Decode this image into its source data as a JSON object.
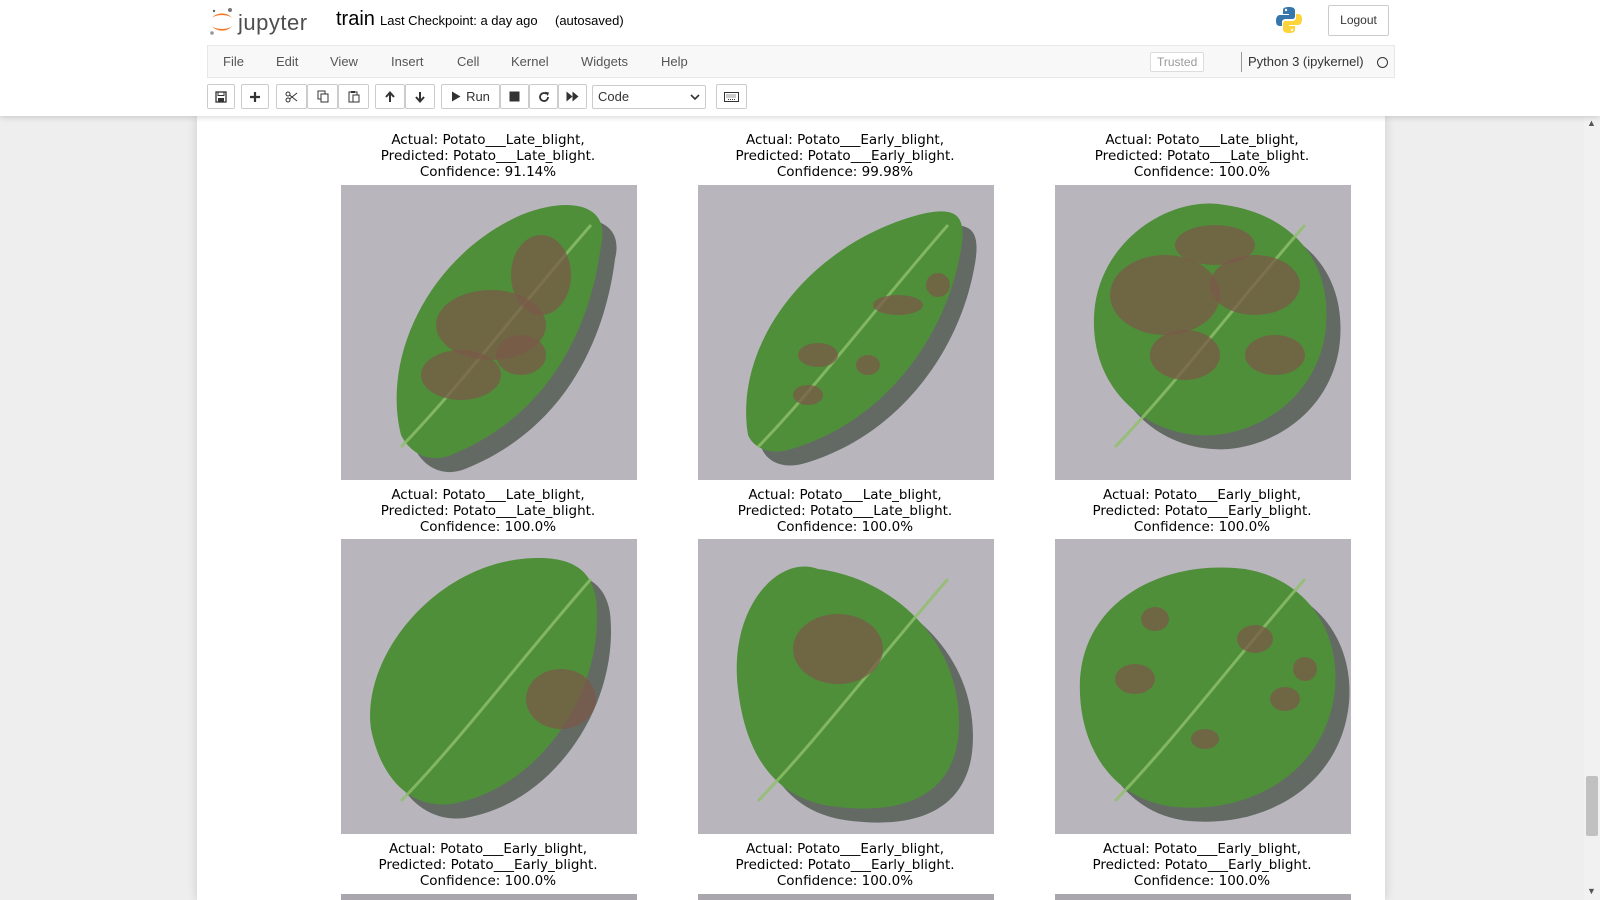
{
  "app": {
    "brand": "jupyter",
    "notebook_name": "train",
    "checkpoint": "Last Checkpoint: a day ago",
    "autosave": "(autosaved)",
    "logout_label": "Logout",
    "python_logo": "python-logo-icon"
  },
  "menu": [
    "File",
    "Edit",
    "View",
    "Insert",
    "Cell",
    "Kernel",
    "Widgets",
    "Help"
  ],
  "status": {
    "trusted": "Trusted",
    "kernel": "Python 3 (ipykernel)",
    "kernel_state": "idle"
  },
  "toolbar": {
    "run_label": "Run",
    "cell_type": "Code",
    "icons": [
      "save-icon",
      "plus-icon",
      "cut-icon",
      "copy-icon",
      "paste-icon",
      "arrow-up-icon",
      "arrow-down-icon",
      "run-icon",
      "stop-icon",
      "restart-icon",
      "fast-forward-icon",
      "keyboard-icon"
    ]
  },
  "results": [
    {
      "actual": "Actual: Potato___Late_blight,",
      "predicted": "Predicted: Potato___Late_blight.",
      "confidence": "Confidence: 91.14%"
    },
    {
      "actual": "Actual: Potato___Early_blight,",
      "predicted": "Predicted: Potato___Early_blight.",
      "confidence": "Confidence: 99.98%"
    },
    {
      "actual": "Actual: Potato___Late_blight,",
      "predicted": "Predicted: Potato___Late_blight.",
      "confidence": "Confidence: 100.0%"
    },
    {
      "actual": "Actual: Potato___Late_blight,",
      "predicted": "Predicted: Potato___Late_blight.",
      "confidence": "Confidence: 100.0%"
    },
    {
      "actual": "Actual: Potato___Late_blight,",
      "predicted": "Predicted: Potato___Late_blight.",
      "confidence": "Confidence: 100.0%"
    },
    {
      "actual": "Actual: Potato___Early_blight,",
      "predicted": "Predicted: Potato___Early_blight.",
      "confidence": "Confidence: 100.0%"
    },
    {
      "actual": "Actual: Potato___Early_blight,",
      "predicted": "Predicted: Potato___Early_blight.",
      "confidence": "Confidence: 100.0%"
    },
    {
      "actual": "Actual: Potato___Early_blight,",
      "predicted": "Predicted: Potato___Early_blight.",
      "confidence": "Confidence: 100.0%"
    },
    {
      "actual": "Actual: Potato___Early_blight,",
      "predicted": "Predicted: Potato___Early_blight.",
      "confidence": "Confidence: 100.0%"
    }
  ],
  "colors": {
    "jupyter_orange": "#f37726",
    "leaf_green": "#4f8f3a",
    "lesion_brown": "#7a5a48",
    "background_gray": "#b9b5bd"
  }
}
